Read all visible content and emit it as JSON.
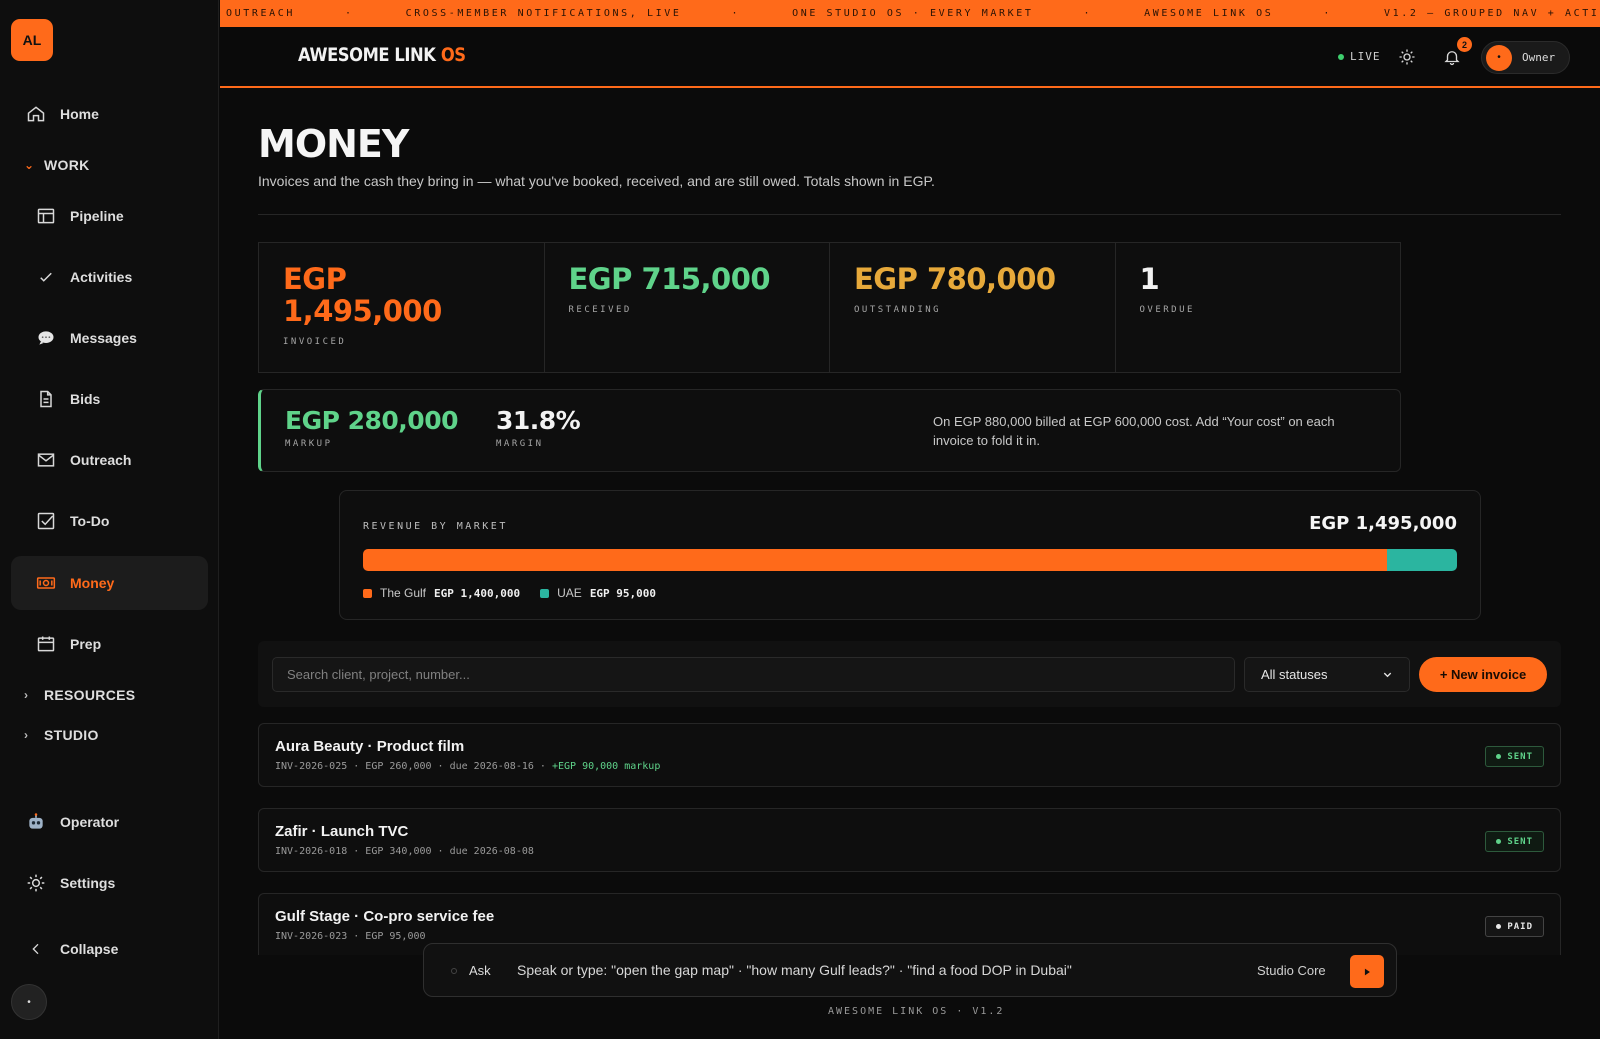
{
  "ticker": [
    "OUTREACH",
    "CROSS-MEMBER NOTIFICATIONS, LIVE",
    "ONE STUDIO OS · EVERY MARKET",
    "AWESOME LINK OS",
    "V1.2 — GROUPED NAV + ACTI"
  ],
  "sidebar": {
    "logo": "AL",
    "home": "Home",
    "group_work": "WORK",
    "items": [
      {
        "label": "Pipeline",
        "icon": "table-icon"
      },
      {
        "label": "Activities",
        "icon": "check-icon"
      },
      {
        "label": "Messages",
        "icon": "speech-bubble-icon"
      },
      {
        "label": "Bids",
        "icon": "document-icon"
      },
      {
        "label": "Outreach",
        "icon": "mail-icon"
      },
      {
        "label": "To-Do",
        "icon": "checkbox-icon"
      },
      {
        "label": "Money",
        "icon": "cash-icon"
      },
      {
        "label": "Prep",
        "icon": "calendar-icon"
      }
    ],
    "group_resources": "RESOURCES",
    "group_studio": "STUDIO",
    "operator": "Operator",
    "settings": "Settings",
    "collapse": "Collapse",
    "avatar": "•"
  },
  "header": {
    "brand_main": "AWESOME LINK",
    "brand_os": "OS",
    "live": "LIVE",
    "notif_count": "2",
    "owner": "Owner",
    "owner_avatar": "•"
  },
  "page": {
    "title": "MONEY",
    "subtitle": "Invoices and the cash they bring in — what you've booked, received, and are still owed. Totals shown in EGP."
  },
  "kpis": [
    {
      "value": "EGP 1,495,000",
      "label": "INVOICED",
      "color": "#ff6a1a"
    },
    {
      "value": "EGP 715,000",
      "label": "RECEIVED",
      "color": "#5fd38a"
    },
    {
      "value": "EGP 780,000",
      "label": "OUTSTANDING",
      "color": "#e7a93a"
    },
    {
      "value": "1",
      "label": "OVERDUE",
      "color": "#f2f2f2"
    }
  ],
  "markup": {
    "markup_value": "EGP 280,000",
    "markup_label": "MARKUP",
    "margin_value": "31.8%",
    "margin_label": "MARGIN",
    "note": "On EGP 880,000 billed at EGP 600,000 cost. Add “Your cost” on each invoice to fold it in."
  },
  "revenue": {
    "label": "REVENUE BY MARKET",
    "total": "EGP 1,495,000",
    "markets": [
      {
        "name": "The Gulf",
        "amount_label": "EGP 1,400,000",
        "value": 1400000,
        "color": "#ff6a1a"
      },
      {
        "name": "UAE",
        "amount_label": "EGP 95,000",
        "value": 95000,
        "color": "#2bb5a0"
      }
    ]
  },
  "toolbar": {
    "search_placeholder": "Search client, project, number...",
    "status_value": "All statuses",
    "new_invoice": "+ New invoice"
  },
  "invoices": [
    {
      "name": "Aura Beauty · Product film",
      "meta": "INV-2026-025 · EGP 260,000 · due 2026-08-16 ·",
      "markup": "+EGP 90,000 markup",
      "status": "SENT"
    },
    {
      "name": "Zafir · Launch TVC",
      "meta": "INV-2026-018 · EGP 340,000 · due 2026-08-08",
      "markup": "",
      "status": "SENT"
    },
    {
      "name": "Gulf Stage · Co-pro service fee",
      "meta": "INV-2026-023 · EGP 95,000",
      "markup": "",
      "status": "PAID"
    }
  ],
  "askbar": {
    "ask": "Ask",
    "placeholder": "Speak or type: \"open the gap map\" · \"how many Gulf leads?\" · \"find a food DOP in Dubai\"",
    "core": "Studio Core"
  },
  "footer": "AWESOME LINK OS · V1.2"
}
